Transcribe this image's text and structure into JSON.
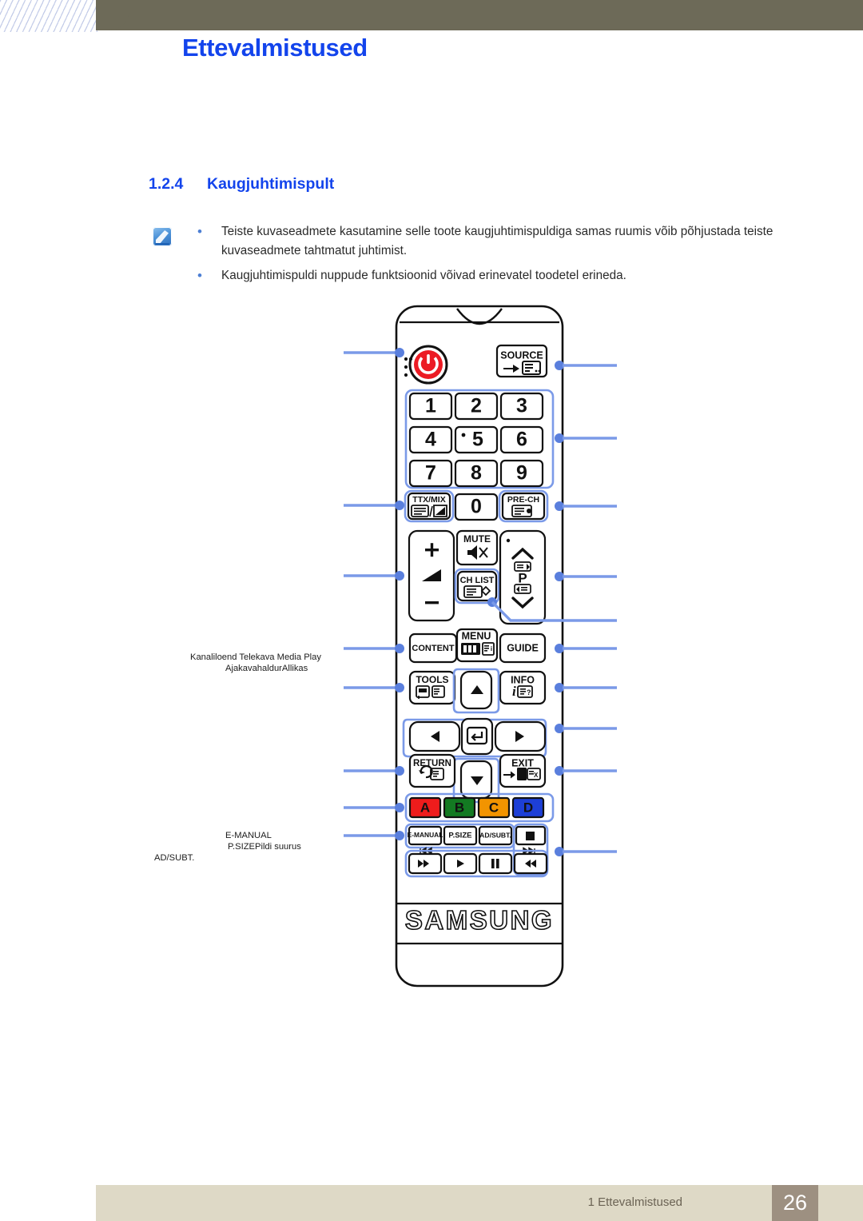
{
  "header": {
    "title": "Ettevalmistused",
    "band_color": "#6d6a58",
    "title_color": "#1344ec"
  },
  "section": {
    "number": "1.2.4",
    "title": "Kaugjuhtimispult"
  },
  "note": {
    "icon": "note-pencil-icon",
    "bullets": [
      "Teiste kuvaseadmete kasutamine selle toote kaugjuhtimispuldiga samas ruumis võib põhjustada teiste kuvaseadmete tahtmatut juhtimist.",
      "Kaugjuhtimispuldi nuppude funktsioonid võivad erinevatel toodetel erineda."
    ]
  },
  "callouts": {
    "left_labels": [
      "Kanaliloend  Telekava   Media Play",
      "AjakavahaldurAllikas",
      "E-MANUAL",
      "P.SIZEPildi suurus",
      "AD/SUBT."
    ]
  },
  "remote": {
    "brand": "SAMSUNG",
    "power_button": "power-icon",
    "source_button": "SOURCE",
    "numpad": [
      "1",
      "2",
      "3",
      "4",
      "5",
      "6",
      "7",
      "8",
      "9",
      "0"
    ],
    "ttx_mix": "TTX/MIX",
    "pre_ch": "PRE-CH",
    "volume_plus": "+",
    "volume_minus": "-",
    "mute": "MUTE",
    "ch_list": "CH LIST",
    "channel_p": "P",
    "content": "CONTENT",
    "menu": "MENU",
    "guide": "GUIDE",
    "tools": "TOOLS",
    "info": "INFO",
    "return": "RETURN",
    "exit": "EXIT",
    "color_buttons": [
      {
        "label": "A",
        "color": "#ee1c1c"
      },
      {
        "label": "B",
        "color": "#137a22"
      },
      {
        "label": "C",
        "color": "#f29400"
      },
      {
        "label": "D",
        "color": "#1d3fd6"
      }
    ],
    "media_row1": [
      "E-MANUAL",
      "P.SIZE",
      "AD/SUBT."
    ],
    "media_stop": "stop-icon",
    "media_row2": [
      "rewind-icon",
      "play-icon",
      "pause-icon",
      "fast-forward-icon"
    ],
    "media_prev_label": "prev-track-icon",
    "media_next_label": "next-track-icon",
    "callout_color": "#7b9ae8"
  },
  "footer": {
    "label": "1 Ettevalmistused",
    "page": "26",
    "band_color": "#ded9c6",
    "page_bg": "#9d9081"
  }
}
